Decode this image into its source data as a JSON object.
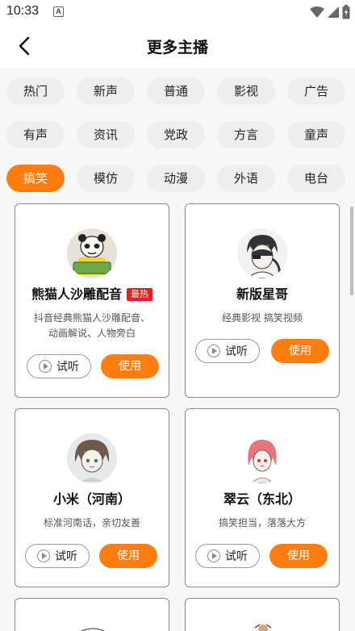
{
  "status": {
    "time": "10:33",
    "notif_letter": "A"
  },
  "header": {
    "title": "更多主播"
  },
  "tags": [
    "热门",
    "新声",
    "普通",
    "影视",
    "广告",
    "有声",
    "资讯",
    "党政",
    "方言",
    "童声",
    "搞笑",
    "模仿",
    "动漫",
    "外语",
    "电台"
  ],
  "active_tag": "搞笑",
  "cards": [
    {
      "name": "熊猫人沙雕配音",
      "badge": "最热",
      "desc": "抖音经典熊猫人沙雕配音、动画解说、人物旁白",
      "listen": "试听",
      "use": "使用"
    },
    {
      "name": "新版星哥",
      "desc": "经典影视 搞笑视频",
      "listen": "试听",
      "use": "使用"
    },
    {
      "name": "小米（河南）",
      "desc": "标准河南话，亲切友善",
      "listen": "试听",
      "use": "使用"
    },
    {
      "name": "翠云（东北）",
      "desc": "搞笑担当，落落大方",
      "listen": "试听",
      "use": "使用"
    }
  ],
  "colors": {
    "accent": "#ff7d10",
    "hot_badge": "#e81d1d"
  }
}
